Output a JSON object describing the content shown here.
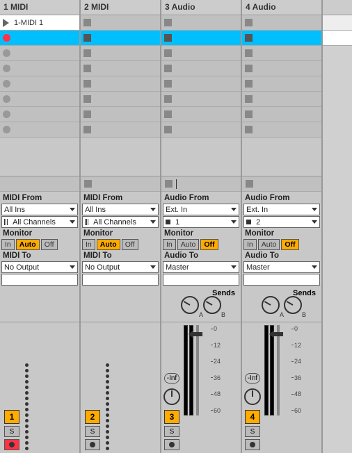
{
  "tracks": [
    {
      "name": "1 MIDI",
      "type": "midi",
      "number": "1",
      "armed": true,
      "clip_slots": [
        {
          "kind": "clip",
          "name": "1-MIDI 1"
        },
        {
          "kind": "selected-rec"
        },
        {
          "kind": "empty-rec"
        },
        {
          "kind": "empty-rec"
        },
        {
          "kind": "empty-rec"
        },
        {
          "kind": "empty-rec"
        },
        {
          "kind": "empty-rec"
        },
        {
          "kind": "empty-rec"
        }
      ],
      "io": {
        "from_label": "MIDI From",
        "from_value": "All Ins",
        "channel_value": "All Channels",
        "channel_icon": "lines",
        "monitor_label": "Monitor",
        "monitor": {
          "in": "In",
          "auto": "Auto",
          "off": "Off",
          "active": "auto"
        },
        "to_label": "MIDI To",
        "to_value": "No Output"
      },
      "solo_label": "S"
    },
    {
      "name": "2 MIDI",
      "type": "midi",
      "number": "2",
      "armed": false,
      "clip_slots": [
        {
          "kind": "stop"
        },
        {
          "kind": "stop"
        },
        {
          "kind": "stop"
        },
        {
          "kind": "stop"
        },
        {
          "kind": "stop"
        },
        {
          "kind": "stop"
        },
        {
          "kind": "stop"
        },
        {
          "kind": "stop"
        }
      ],
      "io": {
        "from_label": "MIDI From",
        "from_value": "All Ins",
        "channel_value": "All Channels",
        "channel_icon": "lines",
        "monitor_label": "Monitor",
        "monitor": {
          "in": "In",
          "auto": "Auto",
          "off": "Off",
          "active": "auto"
        },
        "to_label": "MIDI To",
        "to_value": "No Output"
      },
      "solo_label": "S"
    },
    {
      "name": "3 Audio",
      "type": "audio",
      "number": "3",
      "armed": false,
      "clip_slots": [
        {
          "kind": "stop"
        },
        {
          "kind": "stop"
        },
        {
          "kind": "stop"
        },
        {
          "kind": "stop"
        },
        {
          "kind": "stop"
        },
        {
          "kind": "stop"
        },
        {
          "kind": "stop"
        },
        {
          "kind": "stop"
        }
      ],
      "io": {
        "from_label": "Audio From",
        "from_value": "Ext. In",
        "channel_value": "1",
        "channel_icon": "square",
        "monitor_label": "Monitor",
        "monitor": {
          "in": "In",
          "auto": "Auto",
          "off": "Off",
          "active": "off"
        },
        "to_label": "Audio To",
        "to_value": "Master"
      },
      "sends_label": "Sends",
      "send_a": "A",
      "send_b": "B",
      "vol_display": "-Inf",
      "scale": [
        "0",
        "12",
        "24",
        "36",
        "48",
        "60"
      ],
      "solo_label": "S"
    },
    {
      "name": "4 Audio",
      "type": "audio",
      "number": "4",
      "armed": false,
      "clip_slots": [
        {
          "kind": "stop"
        },
        {
          "kind": "stop"
        },
        {
          "kind": "stop"
        },
        {
          "kind": "stop"
        },
        {
          "kind": "stop"
        },
        {
          "kind": "stop"
        },
        {
          "kind": "stop"
        },
        {
          "kind": "stop"
        }
      ],
      "io": {
        "from_label": "Audio From",
        "from_value": "Ext. In",
        "channel_value": "2",
        "channel_icon": "square",
        "monitor_label": "Monitor",
        "monitor": {
          "in": "In",
          "auto": "Auto",
          "off": "Off",
          "active": "off"
        },
        "to_label": "Audio To",
        "to_value": "Master"
      },
      "sends_label": "Sends",
      "send_a": "A",
      "send_b": "B",
      "vol_display": "-Inf",
      "scale": [
        "0",
        "12",
        "24",
        "36",
        "48",
        "60"
      ],
      "solo_label": "S"
    }
  ]
}
